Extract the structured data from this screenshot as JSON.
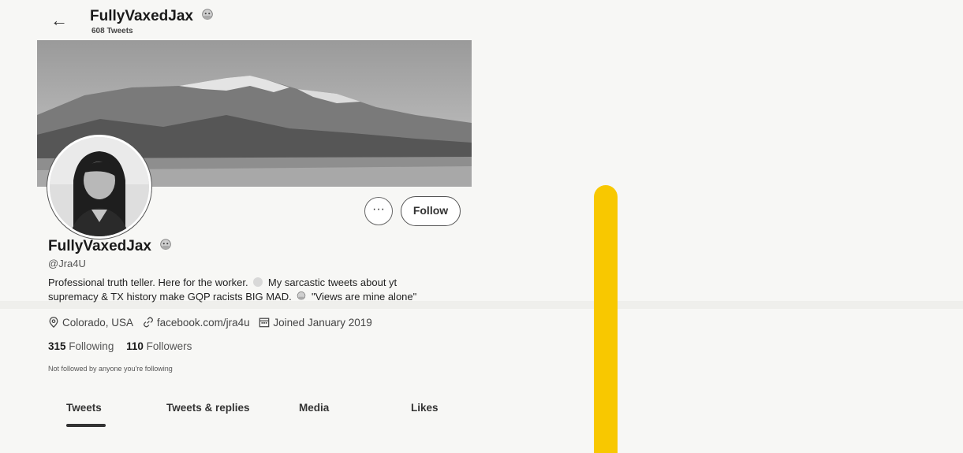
{
  "header": {
    "title": "FullyVaxedJax",
    "tweet_count": "608 Tweets"
  },
  "profile": {
    "display_name": "FullyVaxedJax",
    "handle": "@Jra4U",
    "bio_line1_a": "Professional truth teller. Here for the worker.",
    "bio_line1_b": "My sarcastic tweets about yt",
    "bio_line2_a": "supremacy & TX history make GQP racists BIG MAD.",
    "bio_line2_b": "\"Views are mine alone\"",
    "location": "Colorado, USA",
    "website": "facebook.com/jra4u",
    "joined": "Joined January 2019",
    "following_count": "315",
    "following_label": "Following",
    "followers_count": "110",
    "followers_label": "Followers",
    "not_followed_note": "Not followed by anyone you're following"
  },
  "actions": {
    "more_label": "···",
    "follow_label": "Follow"
  },
  "tabs": [
    {
      "label": "Tweets",
      "active": true
    },
    {
      "label": "Tweets & replies",
      "active": false
    },
    {
      "label": "Media",
      "active": false
    },
    {
      "label": "Likes",
      "active": false
    }
  ],
  "icons": {
    "back": "back-arrow-icon",
    "verified_emoji": "syringe-emoji-icon",
    "location": "location-pin-icon",
    "link": "link-icon",
    "calendar": "calendar-icon"
  },
  "colors": {
    "highlight": "#f8c800",
    "text": "#1a1a1a"
  }
}
